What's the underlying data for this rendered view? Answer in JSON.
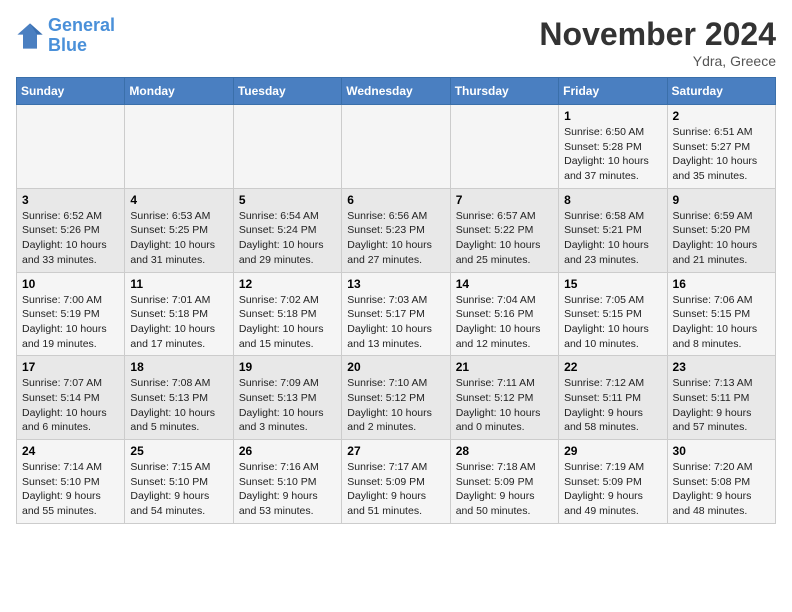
{
  "header": {
    "logo_line1": "General",
    "logo_line2": "Blue",
    "month": "November 2024",
    "location": "Ydra, Greece"
  },
  "weekdays": [
    "Sunday",
    "Monday",
    "Tuesday",
    "Wednesday",
    "Thursday",
    "Friday",
    "Saturday"
  ],
  "weeks": [
    [
      {
        "day": "",
        "info": ""
      },
      {
        "day": "",
        "info": ""
      },
      {
        "day": "",
        "info": ""
      },
      {
        "day": "",
        "info": ""
      },
      {
        "day": "",
        "info": ""
      },
      {
        "day": "1",
        "info": "Sunrise: 6:50 AM\nSunset: 5:28 PM\nDaylight: 10 hours\nand 37 minutes."
      },
      {
        "day": "2",
        "info": "Sunrise: 6:51 AM\nSunset: 5:27 PM\nDaylight: 10 hours\nand 35 minutes."
      }
    ],
    [
      {
        "day": "3",
        "info": "Sunrise: 6:52 AM\nSunset: 5:26 PM\nDaylight: 10 hours\nand 33 minutes."
      },
      {
        "day": "4",
        "info": "Sunrise: 6:53 AM\nSunset: 5:25 PM\nDaylight: 10 hours\nand 31 minutes."
      },
      {
        "day": "5",
        "info": "Sunrise: 6:54 AM\nSunset: 5:24 PM\nDaylight: 10 hours\nand 29 minutes."
      },
      {
        "day": "6",
        "info": "Sunrise: 6:56 AM\nSunset: 5:23 PM\nDaylight: 10 hours\nand 27 minutes."
      },
      {
        "day": "7",
        "info": "Sunrise: 6:57 AM\nSunset: 5:22 PM\nDaylight: 10 hours\nand 25 minutes."
      },
      {
        "day": "8",
        "info": "Sunrise: 6:58 AM\nSunset: 5:21 PM\nDaylight: 10 hours\nand 23 minutes."
      },
      {
        "day": "9",
        "info": "Sunrise: 6:59 AM\nSunset: 5:20 PM\nDaylight: 10 hours\nand 21 minutes."
      }
    ],
    [
      {
        "day": "10",
        "info": "Sunrise: 7:00 AM\nSunset: 5:19 PM\nDaylight: 10 hours\nand 19 minutes."
      },
      {
        "day": "11",
        "info": "Sunrise: 7:01 AM\nSunset: 5:18 PM\nDaylight: 10 hours\nand 17 minutes."
      },
      {
        "day": "12",
        "info": "Sunrise: 7:02 AM\nSunset: 5:18 PM\nDaylight: 10 hours\nand 15 minutes."
      },
      {
        "day": "13",
        "info": "Sunrise: 7:03 AM\nSunset: 5:17 PM\nDaylight: 10 hours\nand 13 minutes."
      },
      {
        "day": "14",
        "info": "Sunrise: 7:04 AM\nSunset: 5:16 PM\nDaylight: 10 hours\nand 12 minutes."
      },
      {
        "day": "15",
        "info": "Sunrise: 7:05 AM\nSunset: 5:15 PM\nDaylight: 10 hours\nand 10 minutes."
      },
      {
        "day": "16",
        "info": "Sunrise: 7:06 AM\nSunset: 5:15 PM\nDaylight: 10 hours\nand 8 minutes."
      }
    ],
    [
      {
        "day": "17",
        "info": "Sunrise: 7:07 AM\nSunset: 5:14 PM\nDaylight: 10 hours\nand 6 minutes."
      },
      {
        "day": "18",
        "info": "Sunrise: 7:08 AM\nSunset: 5:13 PM\nDaylight: 10 hours\nand 5 minutes."
      },
      {
        "day": "19",
        "info": "Sunrise: 7:09 AM\nSunset: 5:13 PM\nDaylight: 10 hours\nand 3 minutes."
      },
      {
        "day": "20",
        "info": "Sunrise: 7:10 AM\nSunset: 5:12 PM\nDaylight: 10 hours\nand 2 minutes."
      },
      {
        "day": "21",
        "info": "Sunrise: 7:11 AM\nSunset: 5:12 PM\nDaylight: 10 hours\nand 0 minutes."
      },
      {
        "day": "22",
        "info": "Sunrise: 7:12 AM\nSunset: 5:11 PM\nDaylight: 9 hours\nand 58 minutes."
      },
      {
        "day": "23",
        "info": "Sunrise: 7:13 AM\nSunset: 5:11 PM\nDaylight: 9 hours\nand 57 minutes."
      }
    ],
    [
      {
        "day": "24",
        "info": "Sunrise: 7:14 AM\nSunset: 5:10 PM\nDaylight: 9 hours\nand 55 minutes."
      },
      {
        "day": "25",
        "info": "Sunrise: 7:15 AM\nSunset: 5:10 PM\nDaylight: 9 hours\nand 54 minutes."
      },
      {
        "day": "26",
        "info": "Sunrise: 7:16 AM\nSunset: 5:10 PM\nDaylight: 9 hours\nand 53 minutes."
      },
      {
        "day": "27",
        "info": "Sunrise: 7:17 AM\nSunset: 5:09 PM\nDaylight: 9 hours\nand 51 minutes."
      },
      {
        "day": "28",
        "info": "Sunrise: 7:18 AM\nSunset: 5:09 PM\nDaylight: 9 hours\nand 50 minutes."
      },
      {
        "day": "29",
        "info": "Sunrise: 7:19 AM\nSunset: 5:09 PM\nDaylight: 9 hours\nand 49 minutes."
      },
      {
        "day": "30",
        "info": "Sunrise: 7:20 AM\nSunset: 5:08 PM\nDaylight: 9 hours\nand 48 minutes."
      }
    ]
  ]
}
